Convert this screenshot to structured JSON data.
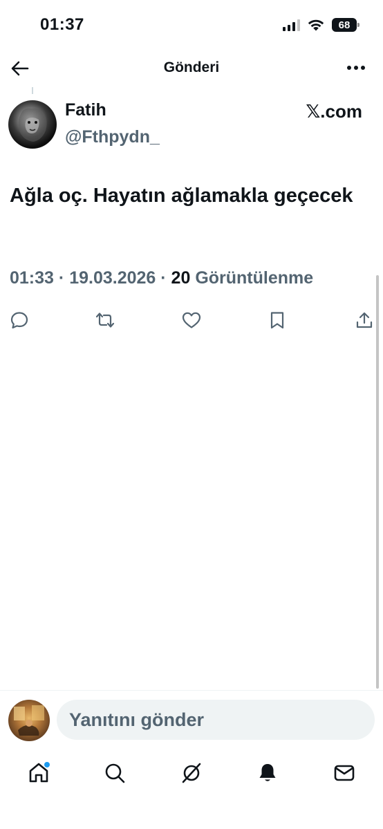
{
  "status_bar": {
    "time": "01:37",
    "battery": "68"
  },
  "header": {
    "title": "Gönderi"
  },
  "post": {
    "display_name": "Fatih",
    "handle": "@Fthpydn_",
    "source": "𝕏.com",
    "text": "Ağla oç. Hayatın ağlamakla geçecek",
    "time": "01:33",
    "date": "19.03.2026",
    "views_count": "20",
    "views_label": "Görüntülenme"
  },
  "reply": {
    "placeholder": "Yanıtını gönder"
  },
  "colors": {
    "text_primary": "#0f1419",
    "text_secondary": "#536471",
    "accent": "#1d9bf0",
    "input_bg": "#eff3f4"
  },
  "icons": {
    "actions": [
      "reply-icon",
      "repost-icon",
      "like-icon",
      "bookmark-icon",
      "share-icon"
    ],
    "tabs": [
      "home-icon",
      "search-icon",
      "grok-icon",
      "notifications-icon",
      "messages-icon"
    ]
  }
}
